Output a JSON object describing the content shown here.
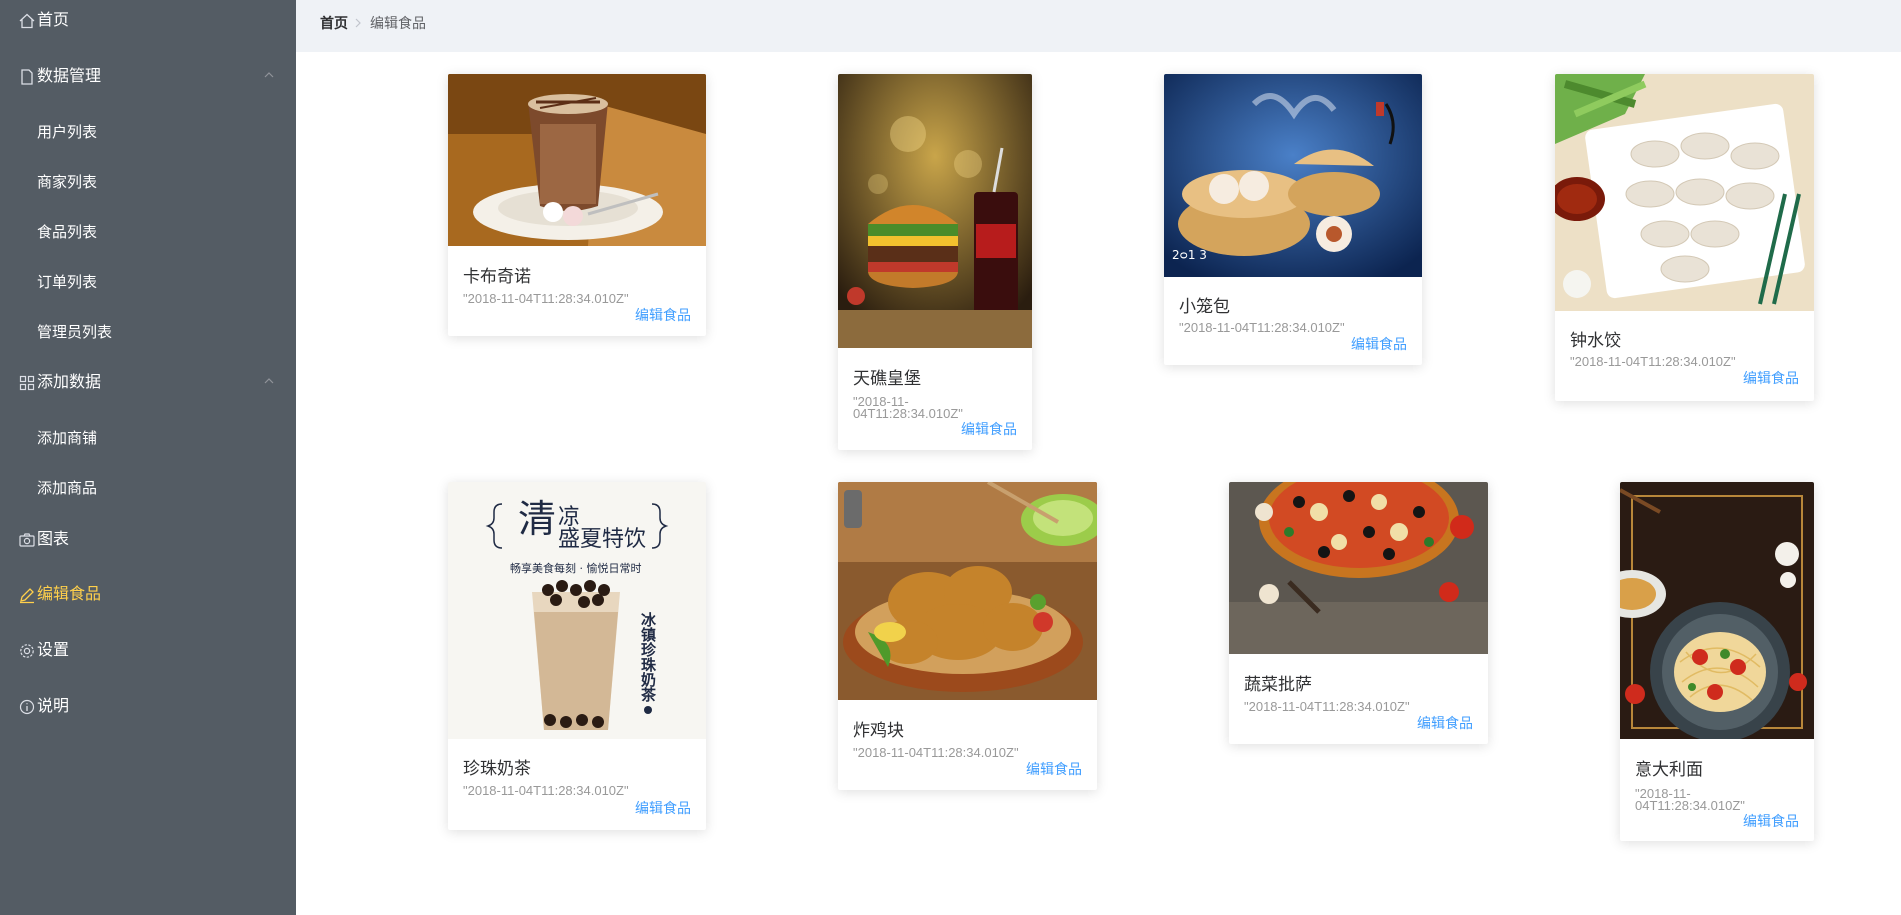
{
  "sidebar": {
    "home": "首页",
    "data_manage": "数据管理",
    "user_list": "用户列表",
    "shop_list": "商家列表",
    "food_list": "食品列表",
    "order_list": "订单列表",
    "admin_list": "管理员列表",
    "add_data": "添加数据",
    "add_shop": "添加商铺",
    "add_food": "添加商品",
    "chart": "图表",
    "edit_food": "编辑食品",
    "settings": "设置",
    "explain": "说明",
    "active_color": "#ffd04b",
    "bg_color": "#545c64"
  },
  "breadcrumb": {
    "home": "首页",
    "current": "编辑食品"
  },
  "foods": [
    {
      "name": "卡布奇诺",
      "time": "\"2018-11-04T11:28:34.010Z\"",
      "action": "编辑食品",
      "image": "cappuccino-photo"
    },
    {
      "name": "天礁皇堡",
      "time": "\"2018-11-04T11:28:34.010Z\"",
      "action": "编辑食品",
      "image": "burger-photo"
    },
    {
      "name": "小笼包",
      "time": "\"2018-11-04T11:28:34.010Z\"",
      "action": "编辑食品",
      "image": "xiaolongbao-photo"
    },
    {
      "name": "钟水饺",
      "time": "\"2018-11-04T11:28:34.010Z\"",
      "action": "编辑食品",
      "image": "dumplings-photo"
    },
    {
      "name": "珍珠奶茶",
      "time": "\"2018-11-04T11:28:34.010Z\"",
      "action": "编辑食品",
      "image": "bubble-tea-poster"
    },
    {
      "name": "炸鸡块",
      "time": "\"2018-11-04T11:28:34.010Z\"",
      "action": "编辑食品",
      "image": "fried-chicken-photo"
    },
    {
      "name": "蔬菜批萨",
      "time": "\"2018-11-04T11:28:34.010Z\"",
      "action": "编辑食品",
      "image": "pizza-photo"
    },
    {
      "name": "意大利面",
      "time": "\"2018-11-04T11:28:34.010Z\"",
      "action": "编辑食品",
      "image": "spaghetti-photo"
    }
  ],
  "poster": {
    "big": "清",
    "line1": "凉",
    "line2": "盛夏特饮",
    "slogan": "畅享美食每刻 · 愉悦日常时",
    "vertical": "冰镇珍珠奶茶"
  }
}
